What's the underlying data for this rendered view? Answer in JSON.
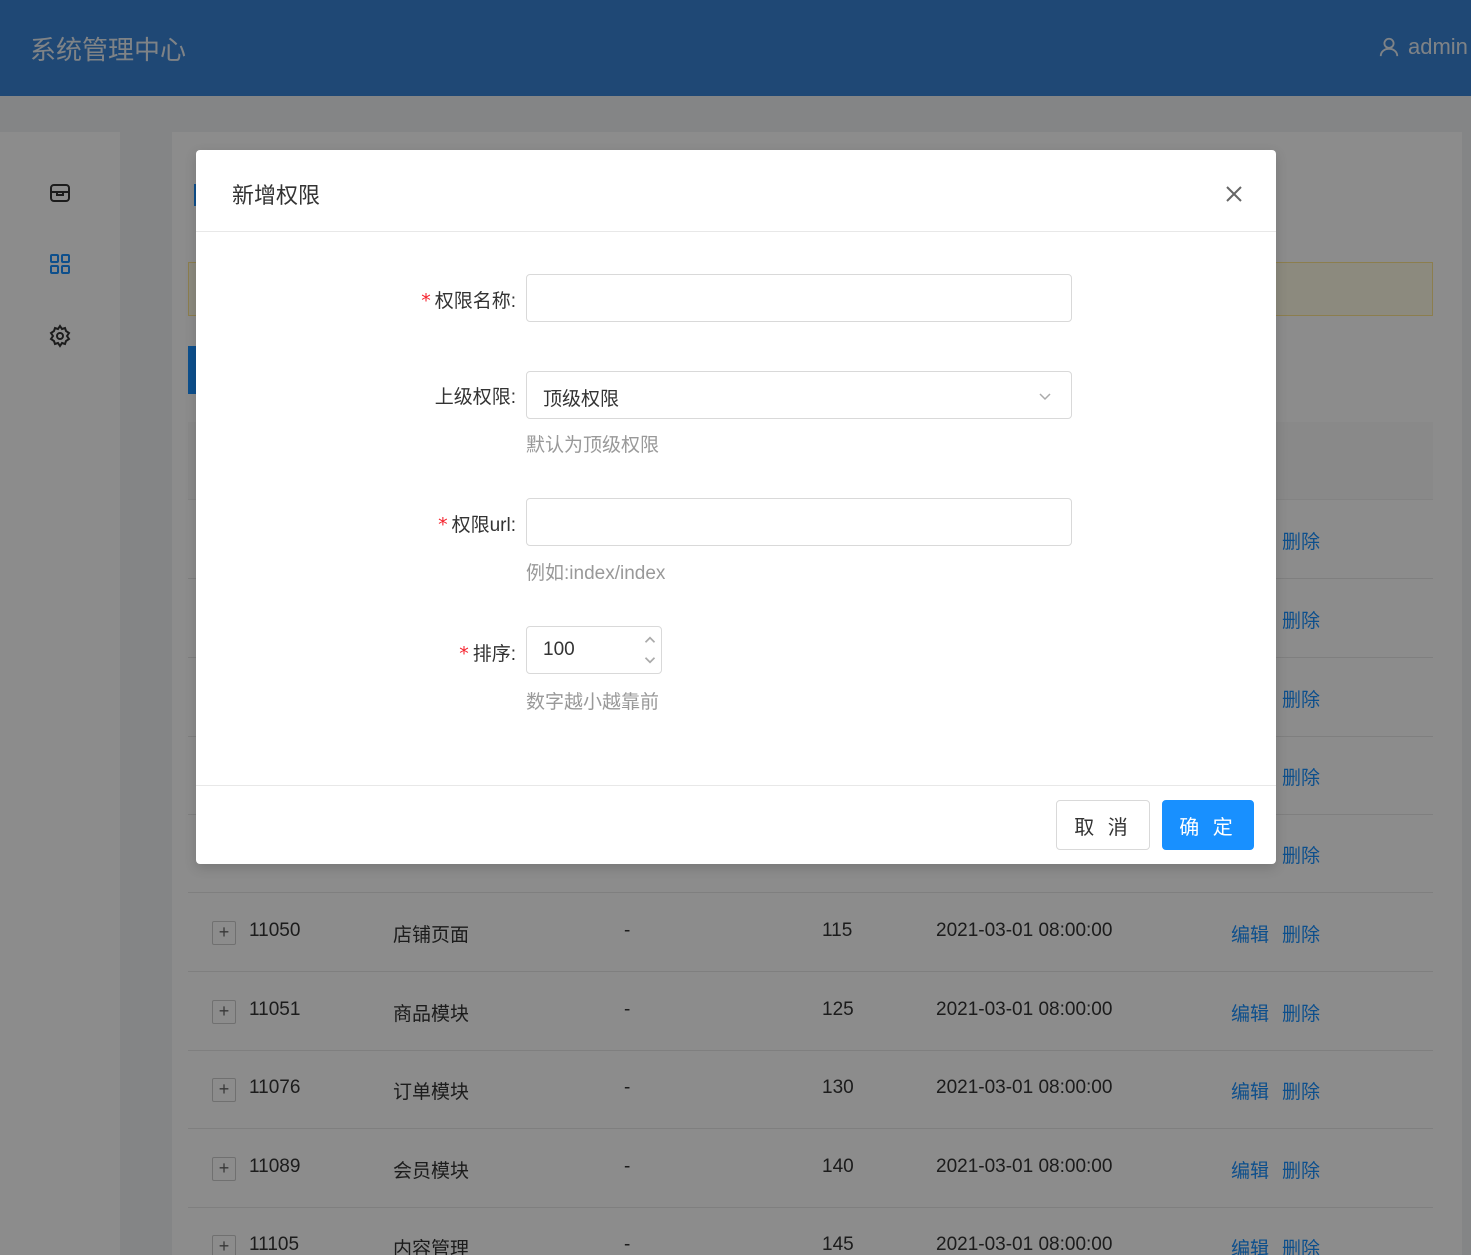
{
  "header": {
    "title": "系统管理中心",
    "user": "admin"
  },
  "sidebar": {
    "items": [
      {
        "icon": "store-icon"
      },
      {
        "icon": "grid-icon"
      },
      {
        "icon": "gear-icon"
      }
    ]
  },
  "table": {
    "rows": [
      {
        "id": "11050",
        "name": "店铺页面",
        "url": "-",
        "sort": "115",
        "time": "2021-03-01 08:00:00",
        "edit": "编辑",
        "delete": "删除"
      },
      {
        "id": "11051",
        "name": "商品模块",
        "url": "-",
        "sort": "125",
        "time": "2021-03-01 08:00:00",
        "edit": "编辑",
        "delete": "删除"
      },
      {
        "id": "11076",
        "name": "订单模块",
        "url": "-",
        "sort": "130",
        "time": "2021-03-01 08:00:00",
        "edit": "编辑",
        "delete": "删除"
      },
      {
        "id": "11089",
        "name": "会员模块",
        "url": "-",
        "sort": "140",
        "time": "2021-03-01 08:00:00",
        "edit": "编辑",
        "delete": "删除"
      },
      {
        "id": "11105",
        "name": "内容管理",
        "url": "-",
        "sort": "145",
        "time": "2021-03-01 08:00:00",
        "edit": "编辑",
        "delete": "删除"
      }
    ],
    "hidden_delete_label": "删除"
  },
  "modal": {
    "title": "新增权限",
    "fields": {
      "name": {
        "label": "权限名称:",
        "required_mark": "*",
        "value": ""
      },
      "parent": {
        "label": "上级权限:",
        "value": "顶级权限",
        "help": "默认为顶级权限"
      },
      "url": {
        "label": "权限url:",
        "required_mark": "*",
        "value": "",
        "help": "例如:index/index"
      },
      "sort": {
        "label": "排序:",
        "required_mark": "*",
        "value": "100",
        "help": "数字越小越靠前"
      }
    },
    "buttons": {
      "cancel": "取 消",
      "ok": "确 定"
    }
  }
}
